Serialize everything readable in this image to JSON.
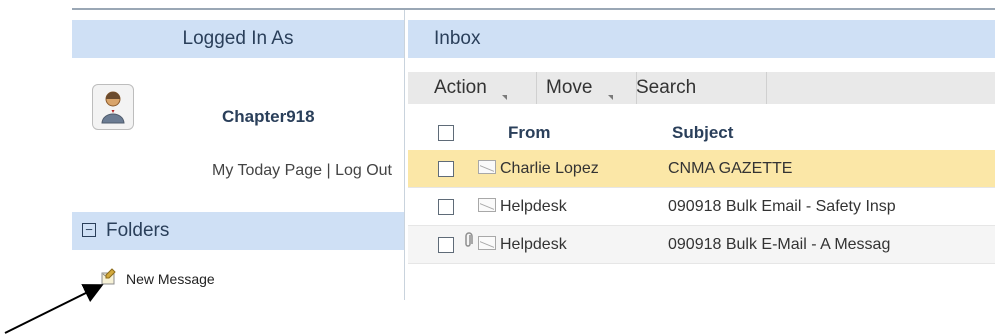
{
  "left": {
    "logged_header": "Logged In As",
    "username": "Chapter918",
    "my_today": "My Today Page",
    "separator": "|",
    "logout": "Log Out",
    "folders_title": "Folders",
    "folders_toggle": "−",
    "new_message": "New Message"
  },
  "right": {
    "inbox_header": "Inbox",
    "toolbar": {
      "action": "Action",
      "move": "Move",
      "search": "Search"
    },
    "table": {
      "headers": {
        "from": "From",
        "subject": "Subject"
      },
      "rows": [
        {
          "from": "Charlie Lopez",
          "subject": "CNMA GAZETTE",
          "selected": true,
          "attachment": false
        },
        {
          "from": "Helpdesk",
          "subject": "090918 Bulk Email - Safety Insp",
          "selected": false,
          "attachment": false
        },
        {
          "from": "Helpdesk",
          "subject": "090918 Bulk E-Mail - A Messag",
          "selected": false,
          "attachment": true
        }
      ]
    }
  },
  "icons": {
    "avatar": "user-avatar-icon",
    "new_message": "new-message-icon",
    "mail": "mail-icon",
    "attachment": "paperclip-icon",
    "checkbox": "checkbox-icon",
    "arrow": "pointer-arrow-icon"
  },
  "colors": {
    "header_bg": "#cfe0f5",
    "selected_row": "#fbe7a7",
    "toolbar_bg": "#e9e9e9",
    "text_primary": "#2a3f5a"
  }
}
